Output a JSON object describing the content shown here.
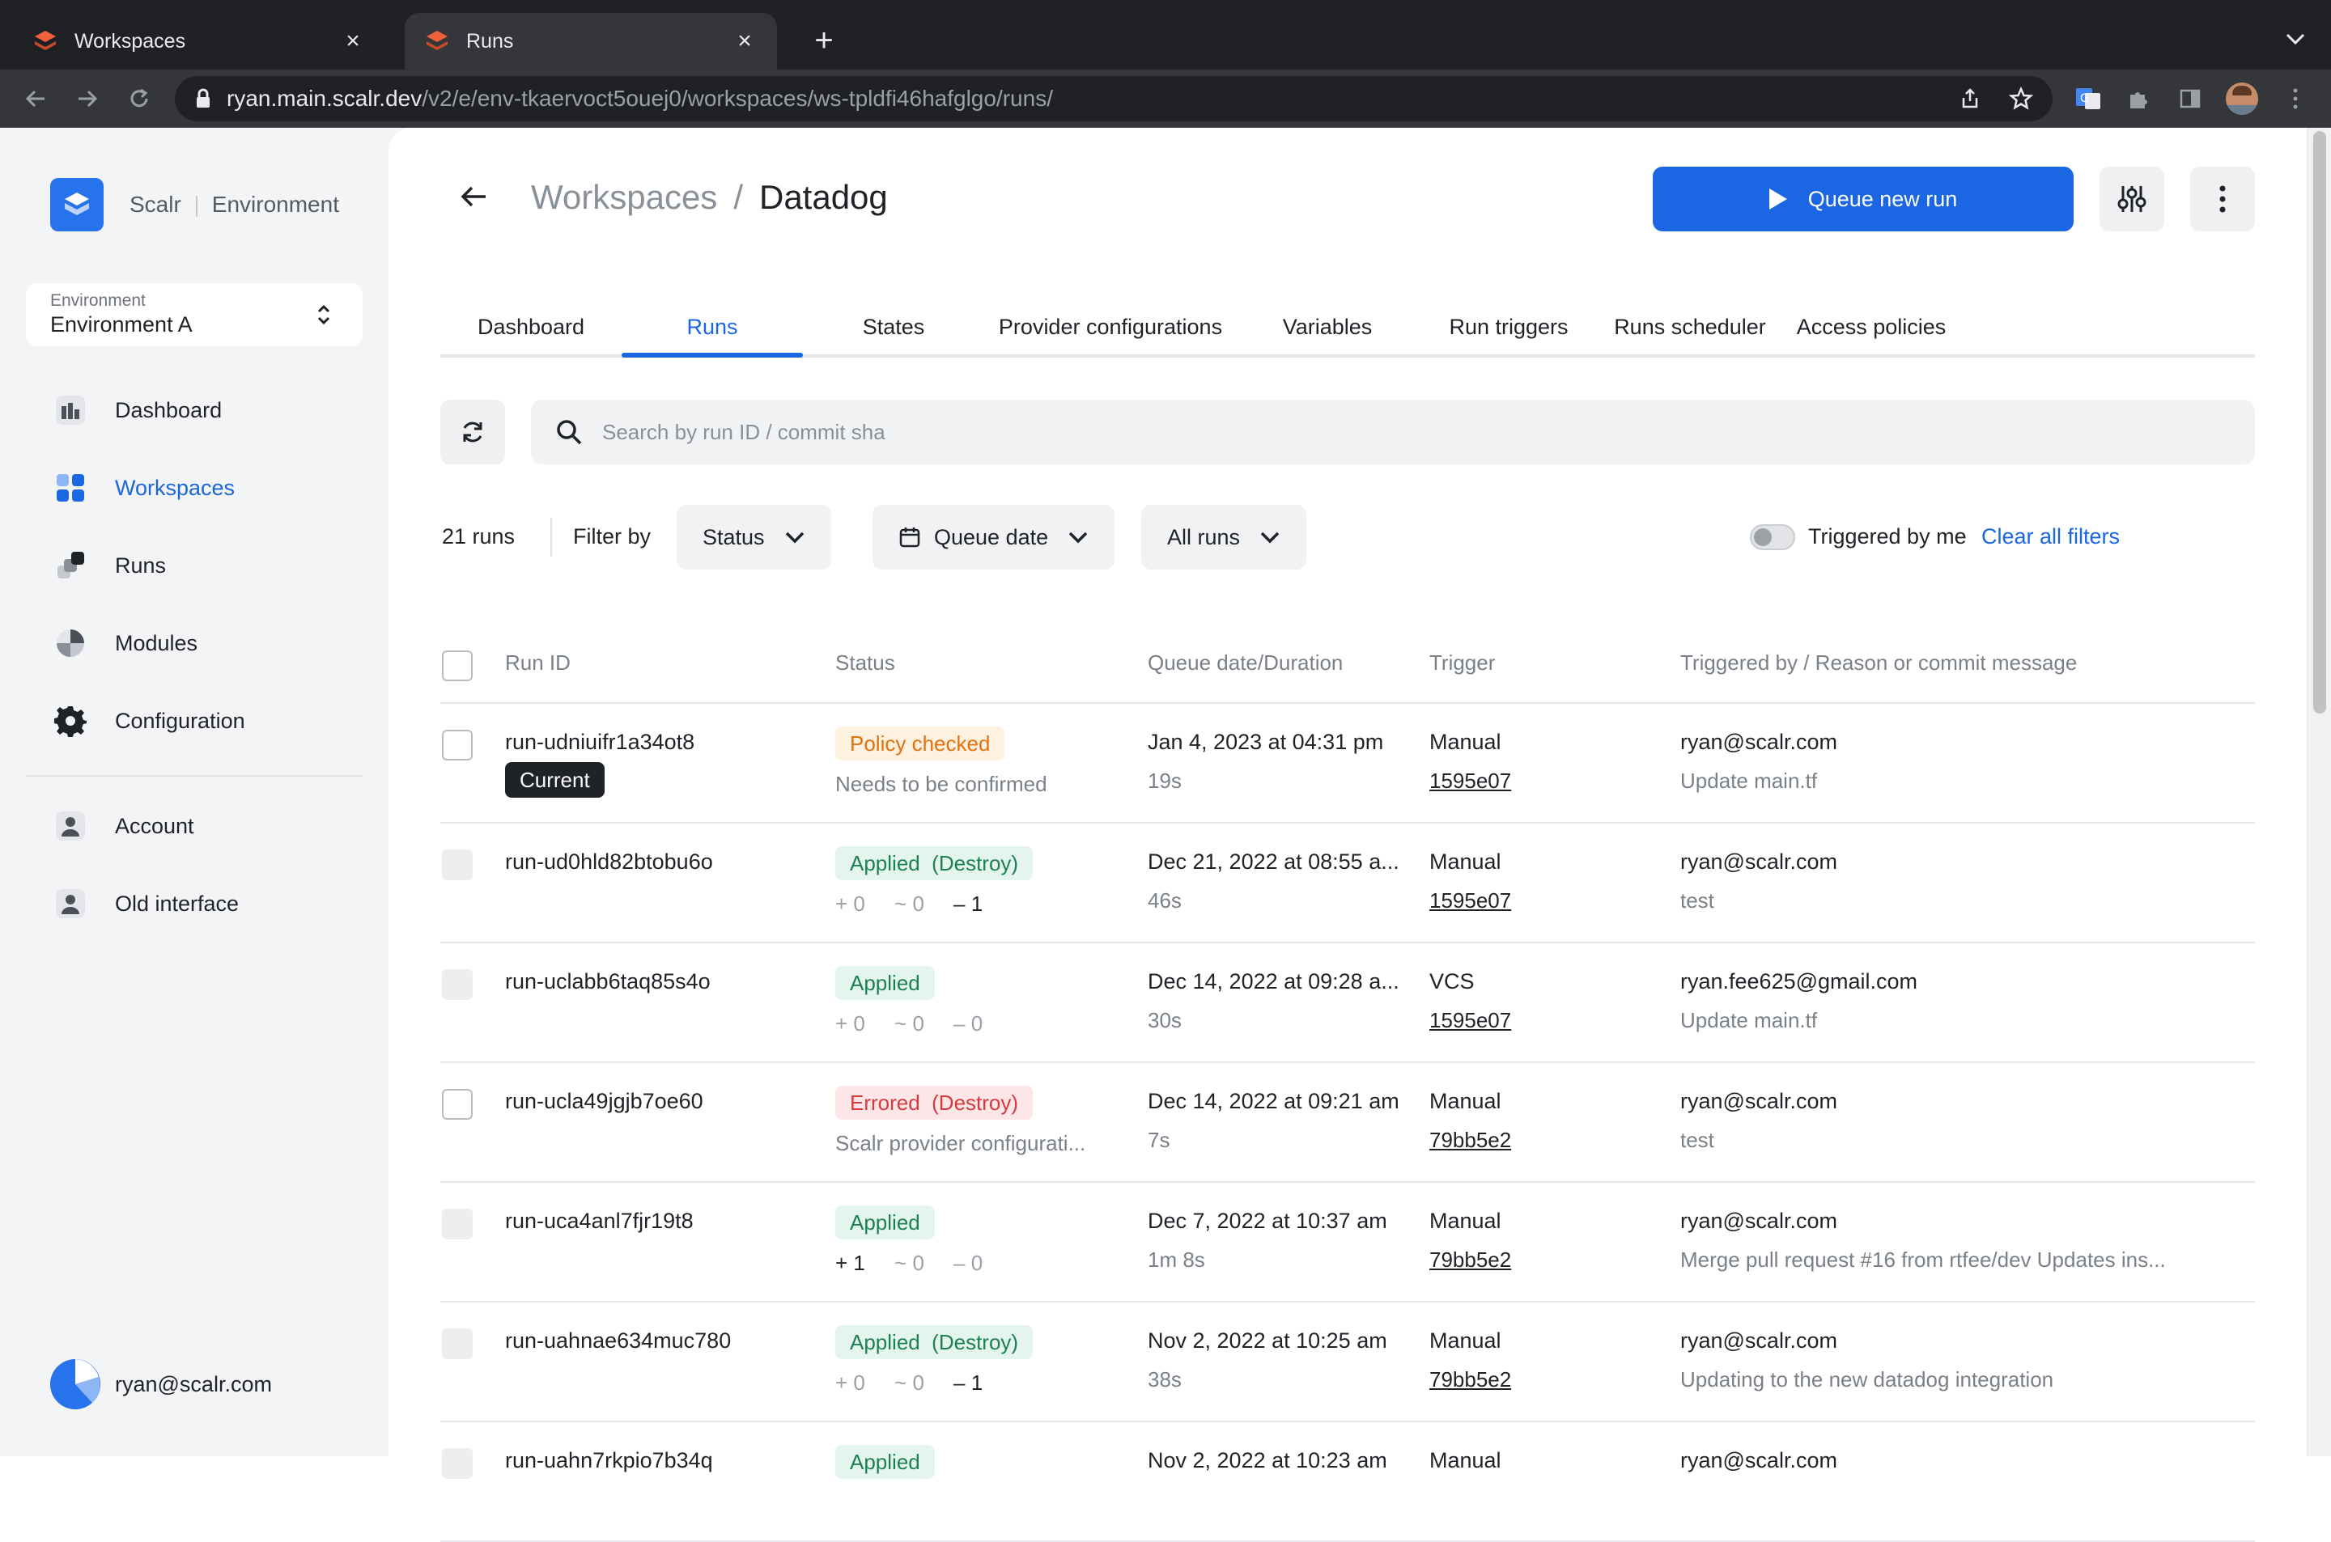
{
  "browser": {
    "tabs": [
      {
        "title": "Workspaces",
        "active": false
      },
      {
        "title": "Runs",
        "active": true
      }
    ],
    "url_host": "ryan.main.scalr.dev",
    "url_path": "/v2/e/env-tkaervoct5ouej0/workspaces/ws-tpldfi46hafglgo/runs/"
  },
  "sidebar": {
    "brand": "Scalr",
    "brand_context": "Environment",
    "env_caption": "Environment",
    "env_value": "Environment A",
    "items": [
      {
        "label": "Dashboard",
        "icon": "dashboard-icon"
      },
      {
        "label": "Workspaces",
        "icon": "workspaces-icon",
        "active": true
      },
      {
        "label": "Runs",
        "icon": "runs-icon"
      },
      {
        "label": "Modules",
        "icon": "modules-icon"
      },
      {
        "label": "Configuration",
        "icon": "gear-icon"
      },
      {
        "label": "Account",
        "icon": "account-icon"
      },
      {
        "label": "Old interface",
        "icon": "old-interface-icon"
      }
    ],
    "user": "ryan@scalr.com"
  },
  "header": {
    "crumb_parent": "Workspaces",
    "crumb_sep": "/",
    "crumb_current": "Datadog",
    "queue_button": "Queue new run"
  },
  "tabs": [
    "Dashboard",
    "Runs",
    "States",
    "Provider configurations",
    "Variables",
    "Run triggers",
    "Runs scheduler",
    "Access policies"
  ],
  "active_tab": "Runs",
  "search": {
    "placeholder": "Search by run ID / commit sha",
    "value": ""
  },
  "filters": {
    "count": "21 runs",
    "filter_by": "Filter by",
    "status": "Status",
    "queue_date": "Queue date",
    "all_runs": "All runs",
    "triggered_by_me": "Triggered by me",
    "triggered_by_me_on": false,
    "clear": "Clear all filters"
  },
  "table": {
    "headers": [
      "Run ID",
      "Status",
      "Queue date/Duration",
      "Trigger",
      "Triggered by / Reason or commit message"
    ],
    "rows": [
      {
        "id": "run-udniuifr1a34ot8",
        "current": "Current",
        "status": "Policy checked",
        "tone": "orange",
        "sub": "Needs to be confirmed",
        "date": "Jan 4, 2023 at 04:31 pm",
        "dur": "19s",
        "trigger": "Manual",
        "sha": "1595e07",
        "by": "ryan@scalr.com",
        "msg": "Update main.tf",
        "checkbox": "enabled"
      },
      {
        "id": "run-ud0hld82btobu6o",
        "status": "Applied  (Destroy)",
        "tone": "green",
        "counts": {
          "add": "0",
          "change": "0",
          "destroy": "1",
          "dark": "destroy"
        },
        "date": "Dec 21, 2022 at 08:55 a...",
        "dur": "46s",
        "trigger": "Manual",
        "sha": "1595e07",
        "by": "ryan@scalr.com",
        "msg": "test",
        "checkbox": "disabled"
      },
      {
        "id": "run-uclabb6taq85s4o",
        "status": "Applied",
        "tone": "green",
        "counts": {
          "add": "0",
          "change": "0",
          "destroy": "0",
          "dark": ""
        },
        "date": "Dec 14, 2022 at 09:28 a...",
        "dur": "30s",
        "trigger": "VCS",
        "sha": "1595e07",
        "by": "ryan.fee625@gmail.com",
        "msg": "Update main.tf",
        "checkbox": "disabled"
      },
      {
        "id": "run-ucla49jgjb7oe60",
        "status": "Errored  (Destroy)",
        "tone": "red",
        "sub": "Scalr provider configurati...",
        "date": "Dec 14, 2022 at 09:21 am",
        "dur": "7s",
        "trigger": "Manual",
        "sha": "79bb5e2",
        "by": "ryan@scalr.com",
        "msg": "test",
        "checkbox": "enabled"
      },
      {
        "id": "run-uca4anl7fjr19t8",
        "status": "Applied",
        "tone": "green",
        "counts": {
          "add": "1",
          "change": "0",
          "destroy": "0",
          "dark": "add"
        },
        "date": "Dec 7, 2022 at 10:37 am",
        "dur": "1m 8s",
        "trigger": "Manual",
        "sha": "79bb5e2",
        "by": "ryan@scalr.com",
        "msg": "Merge pull request #16 from rtfee/dev Updates ins...",
        "checkbox": "disabled"
      },
      {
        "id": "run-uahnae634muc780",
        "status": "Applied  (Destroy)",
        "tone": "green",
        "counts": {
          "add": "0",
          "change": "0",
          "destroy": "1",
          "dark": "destroy"
        },
        "date": "Nov 2, 2022 at 10:25 am",
        "dur": "38s",
        "trigger": "Manual",
        "sha": "79bb5e2",
        "by": "ryan@scalr.com",
        "msg": "Updating to the new datadog integration",
        "checkbox": "disabled"
      },
      {
        "id": "run-uahn7rkpio7b34q",
        "status": "Applied",
        "tone": "green",
        "date": "Nov 2, 2022 at 10:23 am",
        "dur": "",
        "trigger": "Manual",
        "sha": "",
        "by": "ryan@scalr.com",
        "msg": "",
        "checkbox": "disabled"
      }
    ]
  },
  "colors": {
    "accent": "#1a66e3",
    "sidebar_bg": "#f3f4f6"
  }
}
